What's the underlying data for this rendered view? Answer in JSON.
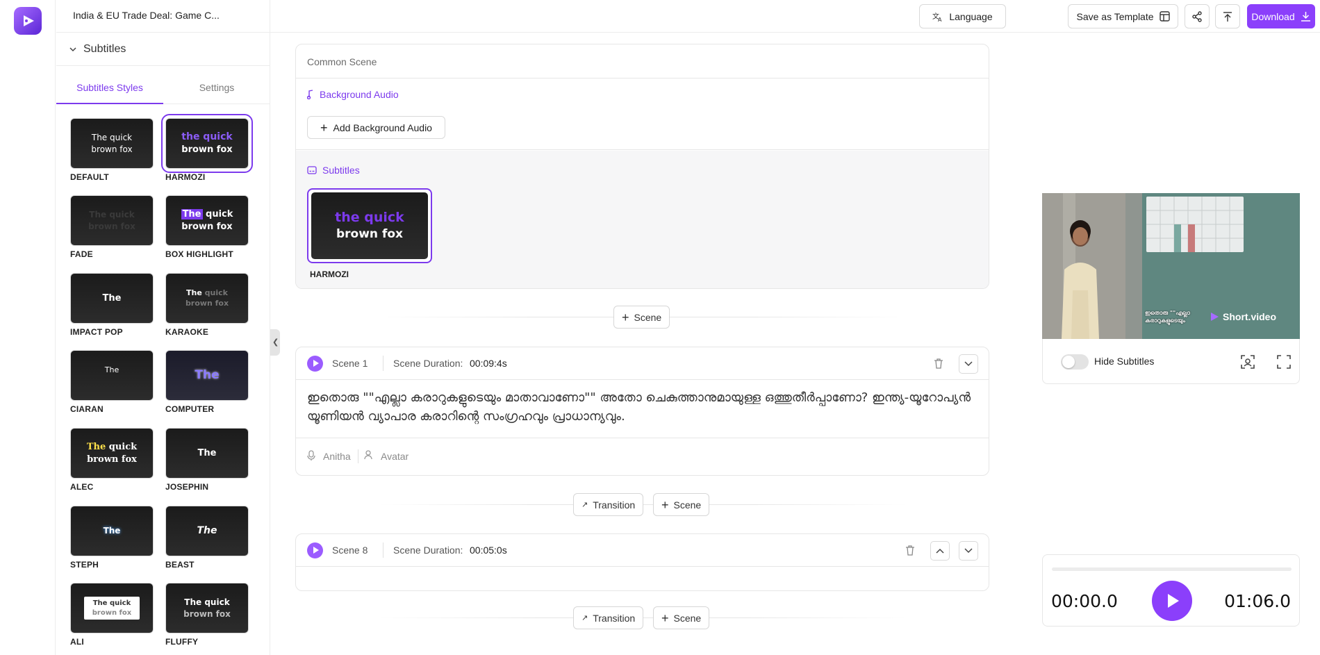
{
  "app": {
    "project_title": "India & EU Trade Deal: Game C..."
  },
  "sidebar": {
    "section_label": "Subtitles",
    "tabs": [
      {
        "label": "Subtitles Styles"
      },
      {
        "label": "Settings"
      }
    ],
    "styles": [
      {
        "name": "DEFAULT",
        "preview": "The quick brown fox"
      },
      {
        "name": "HARMOZI",
        "preview_line1": "the quick",
        "preview_line2": "brown fox"
      },
      {
        "name": "FADE",
        "preview": "The quick brown fox"
      },
      {
        "name": "BOX HIGHLIGHT",
        "preview_hl": "The",
        "preview_rest": " quick",
        "preview_line2": "brown fox"
      },
      {
        "name": "IMPACT POP",
        "preview": "The"
      },
      {
        "name": "KARAOKE",
        "preview_hl": "The",
        "preview_rest": " quick",
        "preview_line2": "brown fox"
      },
      {
        "name": "CIARAN",
        "preview": "The"
      },
      {
        "name": "COMPUTER",
        "preview": "The"
      },
      {
        "name": "ALEC",
        "preview_hl": "The",
        "preview_rest": " quick",
        "preview_line2": "brown fox"
      },
      {
        "name": "JOSEPHIN",
        "preview": "The"
      },
      {
        "name": "STEPH",
        "preview": "The"
      },
      {
        "name": "BEAST",
        "preview": "The"
      },
      {
        "name": "ALI",
        "preview_line1": "The quick",
        "preview_line2": "brown fox"
      },
      {
        "name": "FLUFFY",
        "preview_line1": "The quick",
        "preview_line2": "brown fox"
      }
    ]
  },
  "toolbar": {
    "language_label": "Language",
    "save_template_label": "Save as Template",
    "download_label": "Download"
  },
  "common_scene": {
    "header": "Common Scene",
    "background_audio_label": "Background Audio",
    "add_background_audio_label": "Add Background Audio",
    "subtitles_label": "Subtitles",
    "selected_style": {
      "line1": "the quick",
      "line2": "brown fox",
      "name": "HARMOZI"
    }
  },
  "actions": {
    "scene_label": "Scene",
    "transition_label": "Transition"
  },
  "scenes": [
    {
      "title": "Scene 1",
      "duration_label": "Scene Duration:",
      "duration": "00:09:4s",
      "text": "ഇതൊരു \"\"എല്ലാ കരാറുകളുടെയും മാതാവാണോ\"\" അതോ ചെകുത്താനുമായുള്ള ഒത്തുതീർപ്പാണോ? ഇന്ത്യ-യൂറോപ്യൻ യൂണിയൻ വ്യാപാര കരാറിന്റെ സംഗ്രഹവും പ്രാധാന്യവും.",
      "voice": "Anitha",
      "avatar": "Avatar"
    },
    {
      "title": "Scene 8",
      "duration_label": "Scene Duration:",
      "duration": "00:05:0s"
    }
  ],
  "preview": {
    "caption_line1": "ഇതൊരു \"\"എല്ലാ",
    "caption_line2": "കരാറുകളുടെയും",
    "watermark": "Short.video",
    "hide_subtitles_label": "Hide Subtitles",
    "subtitles_hidden": false
  },
  "player": {
    "current_time": "00:00.0",
    "total_time": "01:06.0",
    "progress": 0
  },
  "colors": {
    "accent": "#7c3aed",
    "download_bg": "#8b3ffb"
  },
  "icons": [
    "logo-icon",
    "chevron-down-icon",
    "language-icon",
    "template-icon",
    "share-icon",
    "export-icon",
    "download-icon",
    "music-note-icon",
    "plus-icon",
    "subtitles-icon",
    "play-icon",
    "trash-icon",
    "chevron-up-icon",
    "microphone-icon",
    "avatar-icon",
    "transition-icon",
    "focus-icon",
    "fullscreen-icon",
    "chevron-left-icon"
  ]
}
